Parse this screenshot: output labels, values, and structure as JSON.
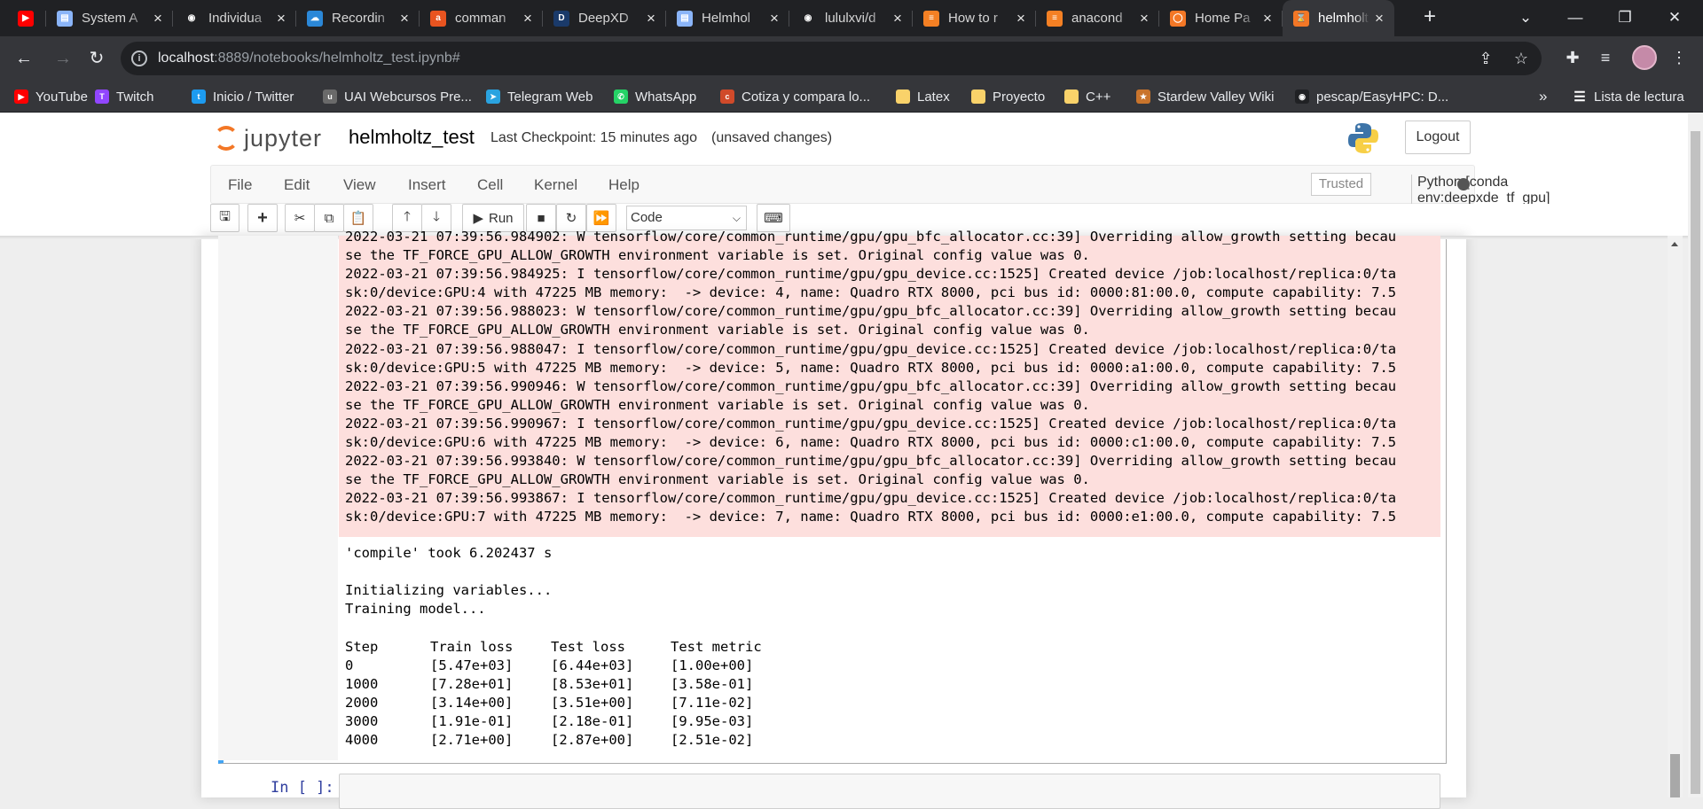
{
  "browser": {
    "tabs": [
      {
        "label": "",
        "favicon": "youtube-icon",
        "color": "#ff0000",
        "glyph": "▶"
      },
      {
        "label": "System A",
        "favicon": "document-icon",
        "color": "#8ab4f8",
        "glyph": "▤"
      },
      {
        "label": "Individua",
        "favicon": "github-icon",
        "color": "#202124",
        "glyph": "◉"
      },
      {
        "label": "Recordin",
        "favicon": "onedrive-icon",
        "color": "#2b88d8",
        "glyph": "☁"
      },
      {
        "label": "comman",
        "favicon": "askubuntu-icon",
        "color": "#e95420",
        "glyph": "a"
      },
      {
        "label": "DeepXD",
        "favicon": "deepxde-icon",
        "color": "#1a3a6a",
        "glyph": "D"
      },
      {
        "label": "Helmhol",
        "favicon": "document-icon",
        "color": "#8ab4f8",
        "glyph": "▤"
      },
      {
        "label": "lululxvi/d",
        "favicon": "github-icon",
        "color": "#202124",
        "glyph": "◉"
      },
      {
        "label": "How to r",
        "favicon": "stackoverflow-icon",
        "color": "#f48024",
        "glyph": "≡"
      },
      {
        "label": "anacond",
        "favicon": "stackoverflow-icon",
        "color": "#f48024",
        "glyph": "≡"
      },
      {
        "label": "Home Pa",
        "favicon": "jupyter-icon",
        "color": "#f37726",
        "glyph": "◯"
      },
      {
        "label": "helmholt",
        "favicon": "hourglass-icon",
        "color": "#f37726",
        "glyph": "⌛",
        "active": true
      }
    ],
    "url_host": "localhost",
    "url_rest": ":8889/notebooks/helmholtz_test.ipynb#",
    "bookmarks": [
      {
        "label": "YouTube",
        "icon": "youtube-icon",
        "color": "#ff0000",
        "glyph": "▶"
      },
      {
        "label": "Twitch",
        "icon": "twitch-icon",
        "color": "#9146ff",
        "glyph": "T"
      },
      {
        "label": "Inicio / Twitter",
        "icon": "twitter-icon",
        "color": "#1d9bf0",
        "glyph": "t"
      },
      {
        "label": "UAI Webcursos Pre...",
        "icon": "uai-icon",
        "color": "#6a6a6a",
        "glyph": "u"
      },
      {
        "label": "Telegram Web",
        "icon": "telegram-icon",
        "color": "#2aa3e0",
        "glyph": "➤"
      },
      {
        "label": "WhatsApp",
        "icon": "whatsapp-icon",
        "color": "#25d366",
        "glyph": "✆"
      },
      {
        "label": "Cotiza y compara lo...",
        "icon": "cotiza-icon",
        "color": "#d04a2a",
        "glyph": "c"
      },
      {
        "label": "Latex",
        "icon": "folder-icon",
        "color": "#f9d26a",
        "glyph": ""
      },
      {
        "label": "Proyecto",
        "icon": "folder-icon",
        "color": "#f9d26a",
        "glyph": ""
      },
      {
        "label": "C++",
        "icon": "folder-icon",
        "color": "#f9d26a",
        "glyph": ""
      },
      {
        "label": "Stardew Valley Wiki",
        "icon": "stardew-icon",
        "color": "#c9742c",
        "glyph": "★"
      },
      {
        "label": "pescap/EasyHPC: D...",
        "icon": "github-icon",
        "color": "#202124",
        "glyph": "◉"
      }
    ],
    "reading_list": "Lista de lectura",
    "overflow": "»"
  },
  "jupyter": {
    "logo_text": "jupyter",
    "notebook_title": "helmholtz_test",
    "checkpoint": "Last Checkpoint: 15 minutes ago",
    "unsaved": "(unsaved changes)",
    "logout": "Logout",
    "menu": [
      "File",
      "Edit",
      "View",
      "Insert",
      "Cell",
      "Kernel",
      "Help"
    ],
    "trusted": "Trusted",
    "kernel": "Python [conda env:deepxde_tf_gpu] *",
    "run_label": "Run",
    "cell_type": "Code",
    "next_prompt": "In [ ]:"
  },
  "output": {
    "stderr_lines": [
      "2022-03-21 07:39:56.984902: W tensorflow/core/common_runtime/gpu/gpu_bfc_allocator.cc:39] Overriding allow_growth setting becau",
      "se the TF_FORCE_GPU_ALLOW_GROWTH environment variable is set. Original config value was 0.",
      "2022-03-21 07:39:56.984925: I tensorflow/core/common_runtime/gpu/gpu_device.cc:1525] Created device /job:localhost/replica:0/ta",
      "sk:0/device:GPU:4 with 47225 MB memory:  -> device: 4, name: Quadro RTX 8000, pci bus id: 0000:81:00.0, compute capability: 7.5",
      "2022-03-21 07:39:56.988023: W tensorflow/core/common_runtime/gpu/gpu_bfc_allocator.cc:39] Overriding allow_growth setting becau",
      "se the TF_FORCE_GPU_ALLOW_GROWTH environment variable is set. Original config value was 0.",
      "2022-03-21 07:39:56.988047: I tensorflow/core/common_runtime/gpu/gpu_device.cc:1525] Created device /job:localhost/replica:0/ta",
      "sk:0/device:GPU:5 with 47225 MB memory:  -> device: 5, name: Quadro RTX 8000, pci bus id: 0000:a1:00.0, compute capability: 7.5",
      "2022-03-21 07:39:56.990946: W tensorflow/core/common_runtime/gpu/gpu_bfc_allocator.cc:39] Overriding allow_growth setting becau",
      "se the TF_FORCE_GPU_ALLOW_GROWTH environment variable is set. Original config value was 0.",
      "2022-03-21 07:39:56.990967: I tensorflow/core/common_runtime/gpu/gpu_device.cc:1525] Created device /job:localhost/replica:0/ta",
      "sk:0/device:GPU:6 with 47225 MB memory:  -> device: 6, name: Quadro RTX 8000, pci bus id: 0000:c1:00.0, compute capability: 7.5",
      "2022-03-21 07:39:56.993840: W tensorflow/core/common_runtime/gpu/gpu_bfc_allocator.cc:39] Overriding allow_growth setting becau",
      "se the TF_FORCE_GPU_ALLOW_GROWTH environment variable is set. Original config value was 0.",
      "2022-03-21 07:39:56.993867: I tensorflow/core/common_runtime/gpu/gpu_device.cc:1525] Created device /job:localhost/replica:0/ta",
      "sk:0/device:GPU:7 with 47225 MB memory:  -> device: 7, name: Quadro RTX 8000, pci bus id: 0000:e1:00.0, compute capability: 7.5"
    ],
    "stdout_lines": [
      "'compile' took 6.202437 s",
      "",
      "Initializing variables...",
      "Training model..."
    ],
    "table_headers": [
      "Step",
      "Train loss",
      "Test loss",
      "Test metric"
    ],
    "table_rows": [
      [
        "0",
        "[5.47e+03]",
        "[6.44e+03]",
        "[1.00e+00]"
      ],
      [
        "1000",
        "[7.28e+01]",
        "[8.53e+01]",
        "[3.58e-01]"
      ],
      [
        "2000",
        "[3.14e+00]",
        "[3.51e+00]",
        "[7.11e-02]"
      ],
      [
        "3000",
        "[1.91e-01]",
        "[2.18e-01]",
        "[9.95e-03]"
      ],
      [
        "4000",
        "[2.71e+00]",
        "[2.87e+00]",
        "[2.51e-02]"
      ]
    ]
  }
}
